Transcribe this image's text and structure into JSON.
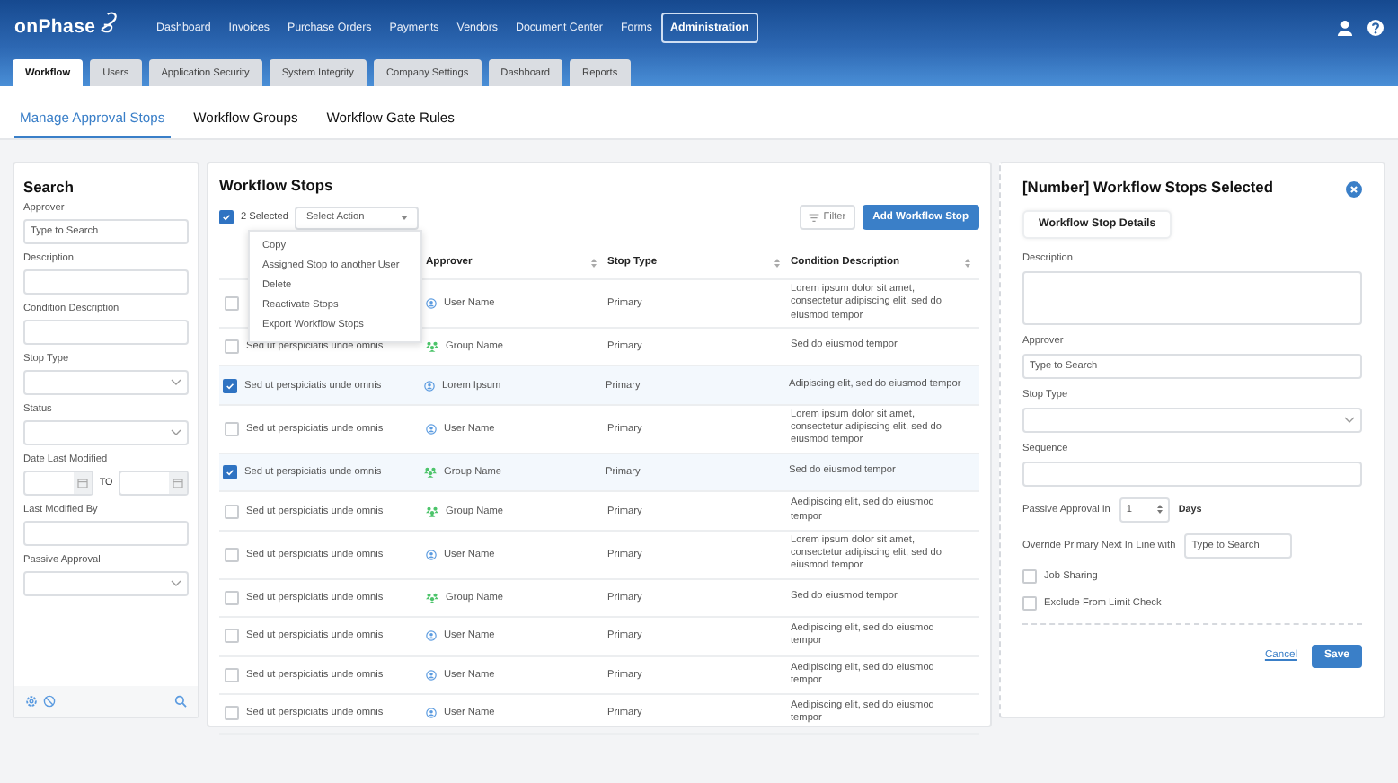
{
  "header": {
    "logo": "onPhase",
    "nav": [
      {
        "label": "Dashboard",
        "selected": false
      },
      {
        "label": "Invoices",
        "selected": false
      },
      {
        "label": "Purchase Orders",
        "selected": false
      },
      {
        "label": "Payments",
        "selected": false
      },
      {
        "label": "Vendors",
        "selected": false
      },
      {
        "label": "Document Center",
        "selected": false
      },
      {
        "label": "Forms",
        "selected": false
      },
      {
        "label": "Administration",
        "selected": true
      }
    ]
  },
  "tabs": [
    {
      "label": "Workflow",
      "selected": true
    },
    {
      "label": "Users",
      "selected": false
    },
    {
      "label": "Application Security",
      "selected": false
    },
    {
      "label": "System Integrity",
      "selected": false
    },
    {
      "label": "Company Settings",
      "selected": false
    },
    {
      "label": "Dashboard",
      "selected": false
    },
    {
      "label": "Reports",
      "selected": false
    }
  ],
  "subtabs": [
    {
      "label": "Manage Approval Stops",
      "selected": true
    },
    {
      "label": "Workflow Groups",
      "selected": false
    },
    {
      "label": "Workflow Gate Rules",
      "selected": false
    }
  ],
  "search": {
    "title": "Search",
    "fields": [
      {
        "label": "Approver",
        "kind": "text",
        "placeholder": "Type to Search"
      },
      {
        "label": "Description",
        "kind": "text"
      },
      {
        "label": "Condition Description",
        "kind": "text"
      },
      {
        "label": "Stop Type",
        "kind": "select"
      },
      {
        "label": "Status",
        "kind": "select"
      },
      {
        "label": "Date Last Modified",
        "kind": "daterange",
        "separator": "TO"
      },
      {
        "label": "Last Modified By",
        "kind": "text"
      },
      {
        "label": "Passive Approval",
        "kind": "select"
      }
    ]
  },
  "stops": {
    "title": "Workflow Stops",
    "select_all_checked": true,
    "selected_count": "2 Selected",
    "action_select": "Select Action",
    "action_menu": [
      "Copy",
      "Assigned Stop to another User",
      "Delete",
      "Reactivate Stops",
      "Export Workflow Stops"
    ],
    "filter": "Filter",
    "add_button": "Add Workflow Stop",
    "columns": [
      "Approver",
      "Stop Type",
      "Condition Description"
    ],
    "rows": [
      {
        "selected": false,
        "kind": "user",
        "approver": "User Name",
        "stop_type": "Primary",
        "condition": "Lorem ipsum dolor sit amet, consectetur adipiscing elit, sed do eiusmod tempor"
      },
      {
        "selected": false,
        "description": "Sed ut perspiciatis unde omnis",
        "kind": "group",
        "approver": "Group Name",
        "stop_type": "Primary",
        "condition": "Sed do eiusmod tempor"
      },
      {
        "selected": true,
        "description": "Sed ut perspiciatis unde omnis",
        "kind": "user",
        "approver": "Lorem Ipsum",
        "stop_type": "Primary",
        "condition": "Adipiscing elit, sed do eiusmod tempor"
      },
      {
        "selected": false,
        "description": "Sed ut perspiciatis unde omnis",
        "kind": "user",
        "approver": "User Name",
        "stop_type": "Primary",
        "condition": "Lorem ipsum dolor sit amet, consectetur adipiscing elit, sed do eiusmod tempor"
      },
      {
        "selected": true,
        "description": "Sed ut perspiciatis unde omnis",
        "kind": "group",
        "approver": "Group Name",
        "stop_type": "Primary",
        "condition": "Sed do eiusmod tempor"
      },
      {
        "selected": false,
        "description": "Sed ut perspiciatis unde omnis",
        "kind": "group",
        "approver": "Group Name",
        "stop_type": "Primary",
        "condition": "Aedipiscing elit, sed do eiusmod tempor"
      },
      {
        "selected": false,
        "description": "Sed ut perspiciatis unde omnis",
        "kind": "user",
        "approver": "User Name",
        "stop_type": "Primary",
        "condition": "Lorem ipsum dolor sit amet, consectetur adipiscing elit, sed do eiusmod tempor"
      },
      {
        "selected": false,
        "description": "Sed ut perspiciatis unde omnis",
        "kind": "group",
        "approver": "Group Name",
        "stop_type": "Primary",
        "condition": "Sed do eiusmod tempor"
      },
      {
        "selected": false,
        "description": "Sed ut perspiciatis unde omnis",
        "kind": "user",
        "approver": "User Name",
        "stop_type": "Primary",
        "condition": "Aedipiscing elit, sed do eiusmod tempor"
      },
      {
        "selected": false,
        "description": "Sed ut perspiciatis unde omnis",
        "kind": "user",
        "approver": "User Name",
        "stop_type": "Primary",
        "condition": "Aedipiscing elit, sed do eiusmod tempor"
      },
      {
        "selected": false,
        "description": "Sed ut perspiciatis unde omnis",
        "kind": "user",
        "approver": "User Name",
        "stop_type": "Primary",
        "condition": "Aedipiscing elit, sed do eiusmod tempor"
      }
    ]
  },
  "details": {
    "title": "[Number] Workflow Stops Selected",
    "section_button": "Workflow Stop Details",
    "fields": [
      {
        "label": "Description",
        "kind": "textarea"
      },
      {
        "label": "Approver",
        "kind": "text",
        "placeholder": "Type to Search"
      },
      {
        "label": "Stop Type",
        "kind": "select"
      },
      {
        "label": "Sequence",
        "kind": "text"
      }
    ],
    "passive": {
      "label": "Passive Approval in",
      "value": "1",
      "unit": "Days"
    },
    "override": {
      "label": "Override Primary Next In Line with",
      "placeholder": "Type to Search"
    },
    "checks": [
      {
        "label": "Job Sharing",
        "checked": false
      },
      {
        "label": "Exclude From Limit Check",
        "checked": false
      }
    ],
    "cancel": "Cancel",
    "save": "Save"
  }
}
